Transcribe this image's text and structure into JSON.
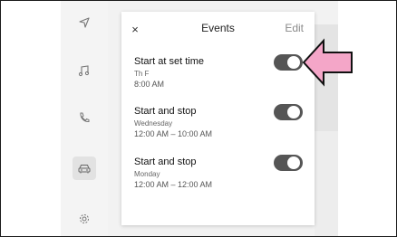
{
  "panel": {
    "title": "Events",
    "edit_label": "Edit",
    "close_label": "×"
  },
  "events": [
    {
      "title": "Start at set time",
      "days": "Th F",
      "time": "8:00 AM",
      "enabled": true
    },
    {
      "title": "Start and stop",
      "days": "Wednesday",
      "time": "12:00 AM – 10:00 AM",
      "enabled": true
    },
    {
      "title": "Start and stop",
      "days": "Monday",
      "time": "12:00 AM – 12:00 AM",
      "enabled": true
    }
  ],
  "sidebar": {
    "items": [
      {
        "icon": "navigation-icon",
        "active": false
      },
      {
        "icon": "music-note-icon",
        "active": false
      },
      {
        "icon": "phone-icon",
        "active": false
      },
      {
        "icon": "car-icon",
        "active": true
      },
      {
        "icon": "settings-gear-icon",
        "active": false
      }
    ]
  },
  "colors": {
    "toggle_on": "#555555",
    "callout_arrow_fill": "#f4a6c8"
  }
}
